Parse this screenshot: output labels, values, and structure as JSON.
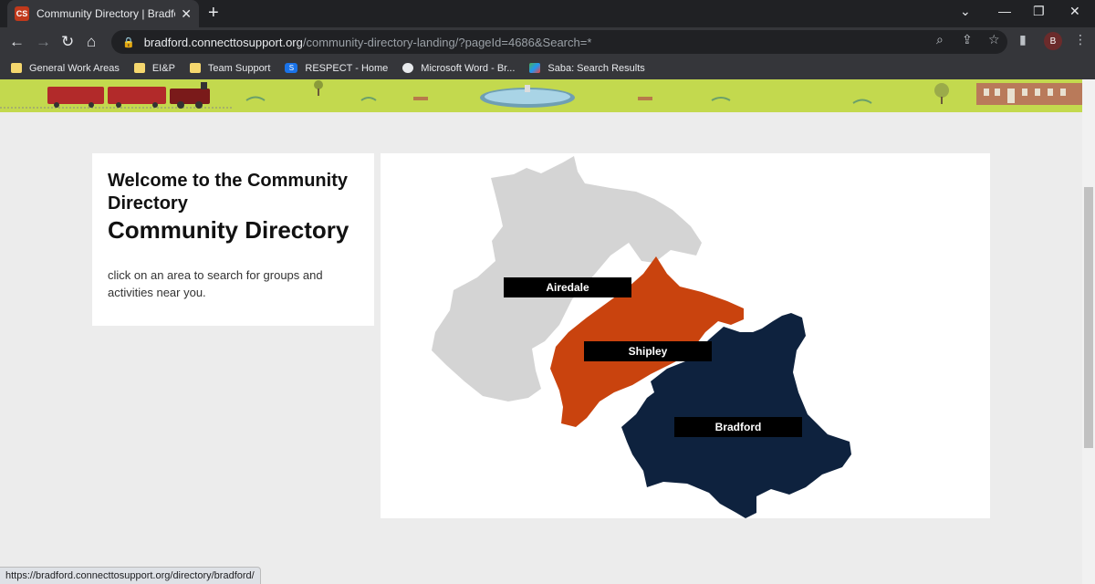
{
  "browser": {
    "tab_title": "Community Directory | Bradford Connect to Support",
    "favicon_text": "CS",
    "url_host": "bradford.connecttosupport.org",
    "url_path": "/community-directory-landing/?pageId=4686&Search=*",
    "profile_initial": "B",
    "bookmarks": [
      {
        "label": "General Work Areas",
        "icon": "folder-icon"
      },
      {
        "label": "EI&P",
        "icon": "folder-icon"
      },
      {
        "label": "Team Support",
        "icon": "folder-icon"
      },
      {
        "label": "RESPECT - Home",
        "icon": "sharepoint-icon"
      },
      {
        "label": "Microsoft Word - Br...",
        "icon": "globe-icon"
      },
      {
        "label": "Saba: Search Results",
        "icon": "saba-icon"
      }
    ],
    "status_url": "https://bradford.connecttosupport.org/directory/bradford/"
  },
  "welcome": {
    "heading_small": "Welcome to the Community Directory",
    "heading_large": "Community Directory",
    "intro": "click on an area to search for groups and activities near you."
  },
  "map": {
    "areas": [
      {
        "name": "Airedale",
        "color": "#d4d4d4"
      },
      {
        "name": "Shipley",
        "color": "#c9430e"
      },
      {
        "name": "Bradford",
        "color": "#0e223e"
      }
    ]
  },
  "colors": {
    "banner": "#c3d94e",
    "page_bg": "#ececec"
  }
}
